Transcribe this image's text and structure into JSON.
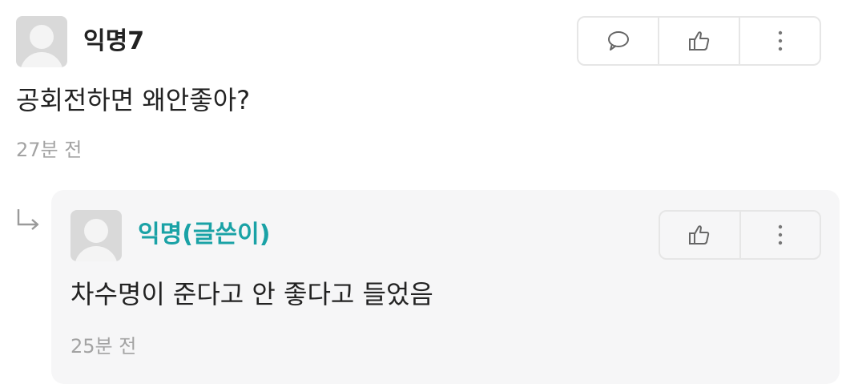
{
  "comment": {
    "author": "익명7",
    "text": "공회전하면 왜안좋아?",
    "time": "27분 전",
    "actions": [
      "reply-icon",
      "thumbs-up-icon",
      "more-vertical-icon"
    ]
  },
  "reply": {
    "author": "익명(글쓴이)",
    "text": "차수명이 준다고 안 좋다고 들었음",
    "time": "25분 전",
    "actions": [
      "thumbs-up-icon",
      "more-vertical-icon"
    ]
  },
  "colors": {
    "author_accent": "#1aa2a6",
    "meta_gray": "#a3a3a3",
    "reply_background": "#f6f6f7",
    "border": "#e6e6e6"
  }
}
